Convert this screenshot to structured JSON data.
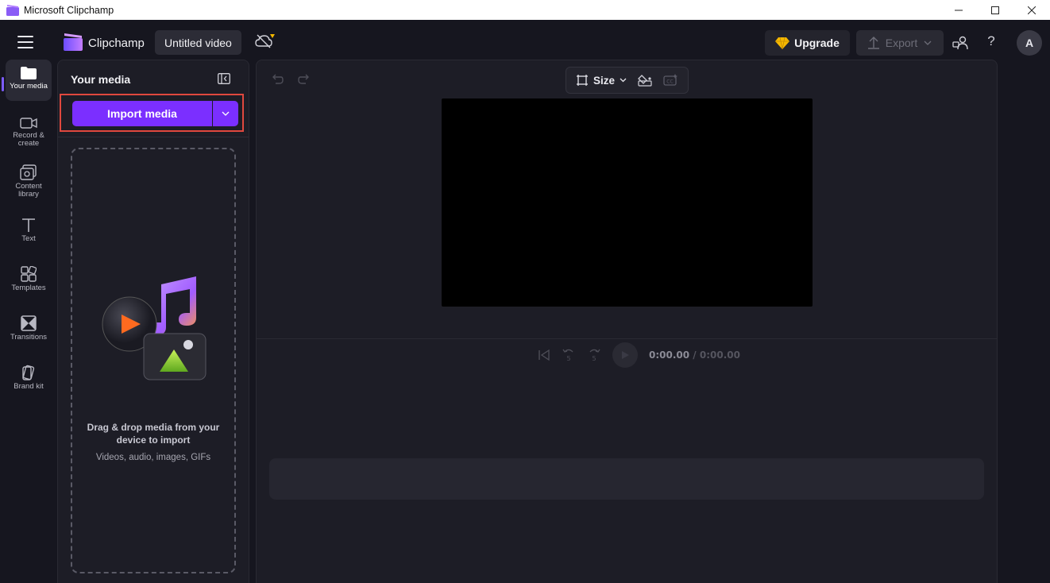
{
  "window": {
    "title": "Microsoft Clipchamp",
    "minimize": "—",
    "maximize": "☐",
    "close": "✕"
  },
  "header": {
    "brand": "Clipchamp",
    "video_title": "Untitled video",
    "upgrade_label": "Upgrade",
    "export_label": "Export",
    "help_label": "?",
    "avatar_initial": "A"
  },
  "rail": {
    "items": [
      {
        "label": "Your media",
        "icon": "folder-icon",
        "active": true
      },
      {
        "label": "Record & create",
        "icon": "video-camera-icon"
      },
      {
        "label": "Content library",
        "icon": "content-library-icon"
      },
      {
        "label": "Text",
        "icon": "text-icon"
      },
      {
        "label": "Templates",
        "icon": "templates-icon"
      },
      {
        "label": "Transitions",
        "icon": "transitions-icon"
      },
      {
        "label": "Brand kit",
        "icon": "brand-kit-icon"
      }
    ]
  },
  "media_panel": {
    "title": "Your media",
    "import_label": "Import media",
    "drop_title": "Drag & drop media from your device to import",
    "drop_subtitle": "Videos, audio, images, GIFs"
  },
  "editor": {
    "size_label": "Size",
    "time_current": "0:00.00",
    "time_separator": " / ",
    "time_total": "0:00.00",
    "skip_back_seconds": "5",
    "skip_forward_seconds": "5"
  },
  "colors": {
    "accent": "#7b2fff",
    "background": "#16161f",
    "panel": "#1d1d26",
    "highlight_border": "#e0483e",
    "upgrade_gem": "#f5b800"
  }
}
